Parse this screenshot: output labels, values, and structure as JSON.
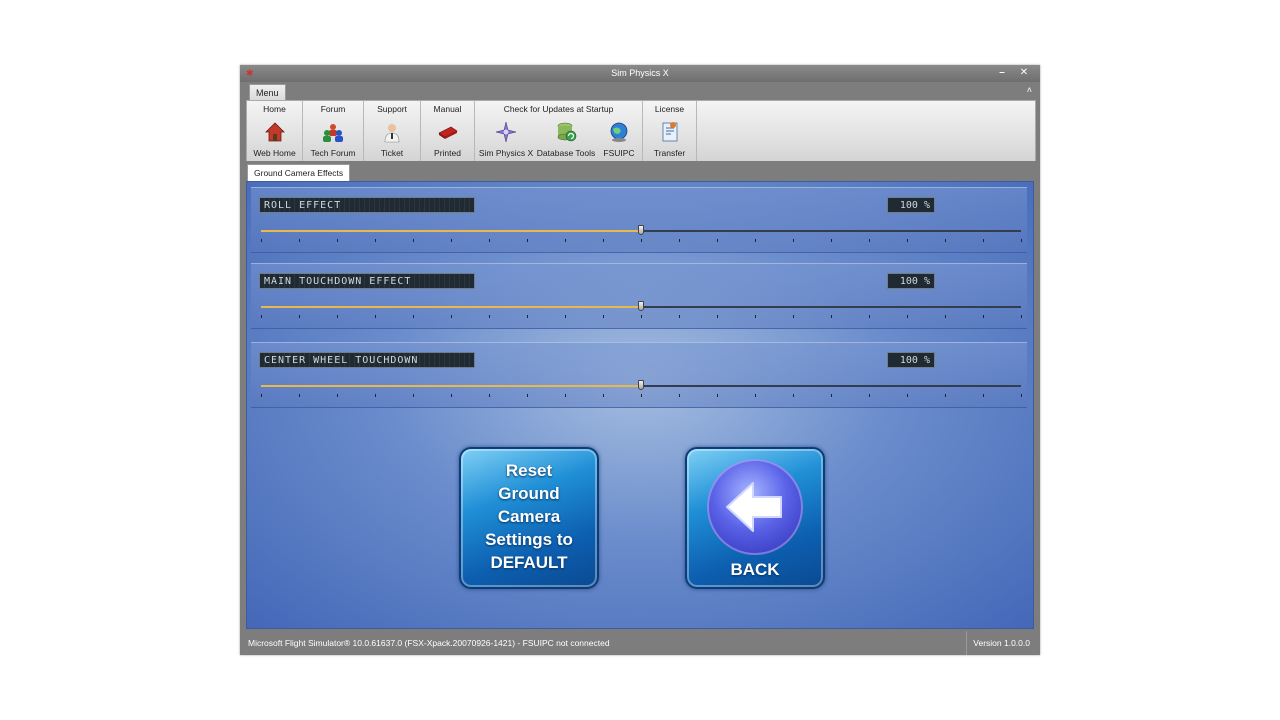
{
  "window": {
    "title": "Sim Physics X",
    "minimize_glyph": "–",
    "close_glyph": "✕"
  },
  "ribbon": {
    "menu_tab": "Menu",
    "collapse_glyph": "˄",
    "groups": [
      {
        "label": "Home",
        "buttons": [
          {
            "label": "Web Home",
            "icon": "home-icon"
          }
        ]
      },
      {
        "label": "Forum",
        "buttons": [
          {
            "label": "Tech Forum",
            "icon": "forum-users-icon"
          }
        ]
      },
      {
        "label": "Support",
        "buttons": [
          {
            "label": "Ticket",
            "icon": "support-person-icon"
          }
        ]
      },
      {
        "label": "Manual",
        "buttons": [
          {
            "label": "Printed",
            "icon": "pdf-book-icon"
          }
        ]
      },
      {
        "label": "Check for Updates at Startup",
        "buttons": [
          {
            "label": "Sim Physics X",
            "icon": "compass-star-icon"
          },
          {
            "label": "Database Tools",
            "icon": "database-refresh-icon"
          },
          {
            "label": "FSUIPC",
            "icon": "globe-icon"
          }
        ]
      },
      {
        "label": "License",
        "buttons": [
          {
            "label": "Transfer",
            "icon": "license-document-icon"
          }
        ]
      }
    ]
  },
  "doc_tab": "Ground Camera Effects",
  "sliders": [
    {
      "label": "ROLL EFFECT",
      "value_text": "100 %",
      "position": 0.5
    },
    {
      "label": "MAIN TOUCHDOWN EFFECT",
      "value_text": "100 %",
      "position": 0.5
    },
    {
      "label": "CENTER WHEEL TOUCHDOWN",
      "value_text": "100 %",
      "position": 0.5
    }
  ],
  "buttons": {
    "reset_lines": [
      "Reset",
      "Ground",
      "Camera",
      "Settings to",
      "DEFAULT"
    ],
    "back": "BACK"
  },
  "status": {
    "left": "Microsoft Flight Simulator® 10.0.61637.0 (FSX-Xpack.20070926-1421)   -  FSUIPC not connected",
    "right": "Version 1.0.0.0"
  },
  "colors": {
    "panel_blue": "#4468b8",
    "slider_fill": "#e8b84a",
    "button_blue": "#1f8fd6"
  }
}
